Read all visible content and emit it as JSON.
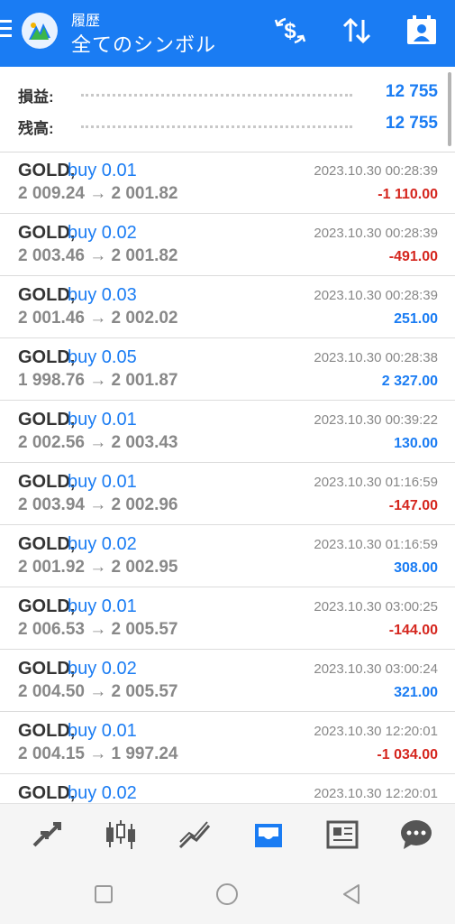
{
  "header": {
    "subtitle": "履歴",
    "title": "全てのシンボル"
  },
  "summary": [
    {
      "label": "損益:",
      "value": "12 755"
    },
    {
      "label": "残高:",
      "value": "12 755"
    }
  ],
  "trades": [
    {
      "symbol": "GOLD,",
      "deal": "buy 0.01",
      "prices": "2 009.24 → 2 001.82",
      "time": "2023.10.30 00:28:39",
      "profit": "-1 110.00"
    },
    {
      "symbol": "GOLD,",
      "deal": "buy 0.02",
      "prices": "2 003.46 → 2 001.82",
      "time": "2023.10.30 00:28:39",
      "profit": "-491.00"
    },
    {
      "symbol": "GOLD,",
      "deal": "buy 0.03",
      "prices": "2 001.46 → 2 002.02",
      "time": "2023.10.30 00:28:39",
      "profit": "251.00"
    },
    {
      "symbol": "GOLD,",
      "deal": "buy 0.05",
      "prices": "1 998.76 → 2 001.87",
      "time": "2023.10.30 00:28:38",
      "profit": "2 327.00"
    },
    {
      "symbol": "GOLD,",
      "deal": "buy 0.01",
      "prices": "2 002.56 → 2 003.43",
      "time": "2023.10.30 00:39:22",
      "profit": "130.00"
    },
    {
      "symbol": "GOLD,",
      "deal": "buy 0.01",
      "prices": "2 003.94 → 2 002.96",
      "time": "2023.10.30 01:16:59",
      "profit": "-147.00"
    },
    {
      "symbol": "GOLD,",
      "deal": "buy 0.02",
      "prices": "2 001.92 → 2 002.95",
      "time": "2023.10.30 01:16:59",
      "profit": "308.00"
    },
    {
      "symbol": "GOLD,",
      "deal": "buy 0.01",
      "prices": "2 006.53 → 2 005.57",
      "time": "2023.10.30 03:00:25",
      "profit": "-144.00"
    },
    {
      "symbol": "GOLD,",
      "deal": "buy 0.02",
      "prices": "2 004.50 → 2 005.57",
      "time": "2023.10.30 03:00:24",
      "profit": "321.00"
    },
    {
      "symbol": "GOLD,",
      "deal": "buy 0.01",
      "prices": "2 004.15 → 1 997.24",
      "time": "2023.10.30 12:20:01",
      "profit": "-1 034.00"
    },
    {
      "symbol": "GOLD,",
      "deal": "buy 0.02",
      "prices": "",
      "time": "2023.10.30 12:20:01",
      "profit": ""
    }
  ],
  "colors": {
    "accent": "#1a7cf3",
    "loss": "#d5261e",
    "muted": "#888888"
  },
  "bottom_nav": [
    "trade-icon",
    "chart-candles-icon",
    "line-chart-icon",
    "history-inbox-icon",
    "news-icon",
    "chat-icon"
  ],
  "active_nav": "history-inbox-icon"
}
